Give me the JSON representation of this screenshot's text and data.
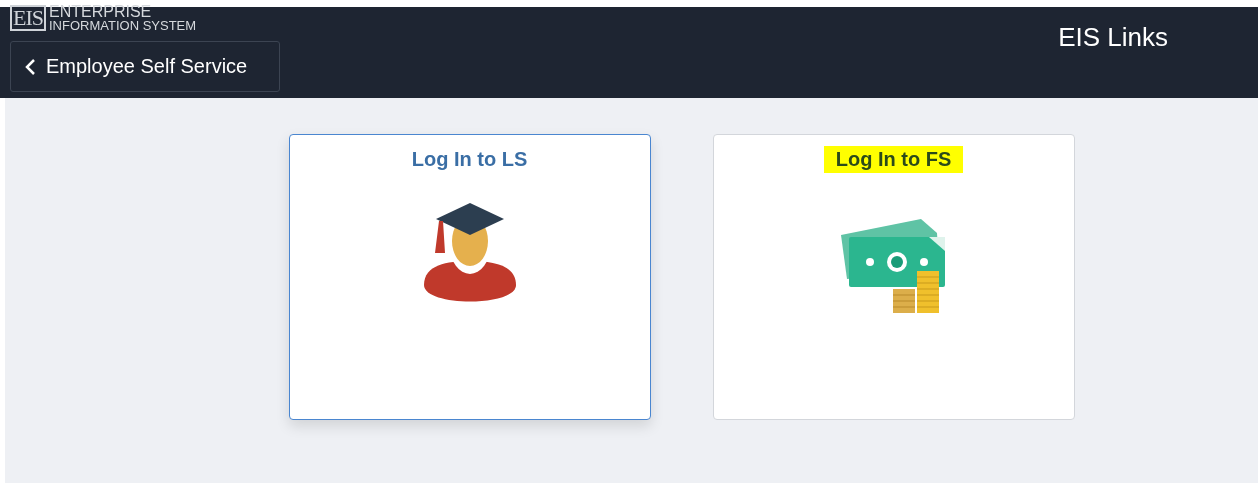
{
  "header": {
    "logo": {
      "mark": "EIS",
      "line_1": "ENTERPRISE",
      "line_2": "INFORMATION SYSTEM"
    },
    "back_button": {
      "label": "Employee Self Service"
    },
    "title": "EIS Links"
  },
  "tiles": [
    {
      "label": "Log In to LS",
      "kind": "graduate",
      "selected": true,
      "highlighted": false
    },
    {
      "label": "Log In to FS",
      "kind": "money",
      "selected": false,
      "highlighted": true
    }
  ]
}
